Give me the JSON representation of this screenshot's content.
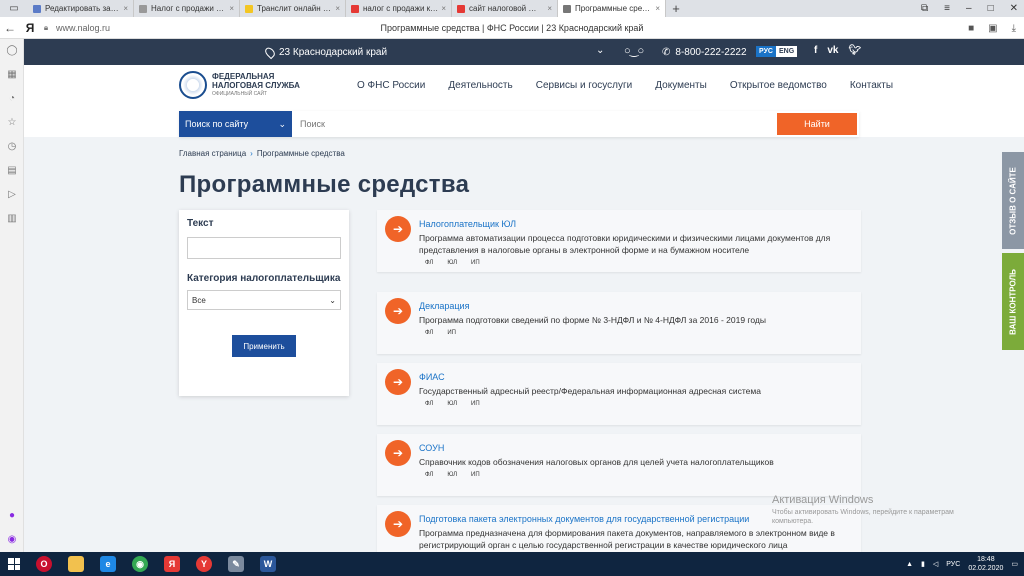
{
  "browser": {
    "tabs": [
      {
        "title": "Редактировать запись ‹ Op",
        "fav_color": "#5b7bc7"
      },
      {
        "title": "Налог с продажи квартиры",
        "fav_color": "#999999"
      },
      {
        "title": "Транслит онлайн — лучший",
        "fav_color": "#f3c623"
      },
      {
        "title": "налог с продажи квартиры",
        "fav_color": "#e53935"
      },
      {
        "title": "сайт налоговой — Яндекс",
        "fav_color": "#e53935"
      },
      {
        "title": "Программные средства",
        "fav_color": "#777777"
      }
    ],
    "url": "www.nalog.ru",
    "page_title": "Программные средства | ФНС России | 23 Краснодарский край"
  },
  "site": {
    "region": "23 Краснодарский край",
    "phone": "8-800-222-2222",
    "lang_ru": "РУС",
    "lang_en": "ENG",
    "social": [
      "f",
      "vk",
      "tw"
    ],
    "logo_line1": "ФЕДЕРАЛЬНАЯ",
    "logo_line2": "НАЛОГОВАЯ СЛУЖБА",
    "logo_line3": "ОФИЦИАЛЬНЫЙ САЙТ",
    "nav": [
      "О ФНС России",
      "Деятельность",
      "Сервисы и госуслуги",
      "Документы",
      "Открытое ведомство",
      "Контакты"
    ],
    "search_scope": "Поиск по сайту",
    "search_placeholder": "Поиск",
    "search_button": "Найти",
    "breadcrumb": [
      "Главная страница",
      "Программные средства"
    ],
    "page_heading": "Программные средства",
    "filter": {
      "text_label": "Текст",
      "category_label": "Категория налогоплательщика",
      "category_value": "Все",
      "apply": "Применить"
    },
    "results": [
      {
        "title": "Налогоплательщик ЮЛ",
        "desc": "Программа автоматизации процесса подготовки юридическими и физическими лицами документов для представления в налоговые органы в электронной форме и на бумажном носителе",
        "tags": [
          "ФЛ",
          "ЮЛ",
          "ИП"
        ]
      },
      {
        "title": "Декларация",
        "desc": "Программа подготовки сведений по форме № 3-НДФЛ и № 4-НДФЛ за 2016 - 2019 годы",
        "tags": [
          "ФЛ",
          "ИП"
        ]
      },
      {
        "title": "ФИАС",
        "desc": "Государственный адресный реестр/Федеральная информационная адресная система",
        "tags": [
          "ФЛ",
          "ЮЛ",
          "ИП"
        ]
      },
      {
        "title": "СОУН",
        "desc": "Справочник кодов обозначения налоговых органов для целей учета налогоплательщиков",
        "tags": [
          "ФЛ",
          "ЮЛ",
          "ИП"
        ]
      },
      {
        "title": "Подготовка пакета электронных документов для государственной регистрации",
        "desc": "Программа предназначена для формирования пакета документов, направляемого в электронном виде в регистрирующий орган с целью государственной регистрации в качестве юридического лица",
        "tags": []
      }
    ],
    "feedback_tab": "ОТЗЫВ О САЙТЕ",
    "control_tab": "ВАШ КОНТРОЛЬ"
  },
  "activation": {
    "title": "Активация Windows",
    "text": "Чтобы активировать Windows, перейдите к параметрам компьютера."
  },
  "taskbar": {
    "lang": "РУС",
    "time": "18:48",
    "date": "02.02.2020"
  },
  "colors": {
    "accent_orange": "#f06428",
    "brand_blue": "#1d4e9c",
    "top_strip": "#2d3c52"
  }
}
